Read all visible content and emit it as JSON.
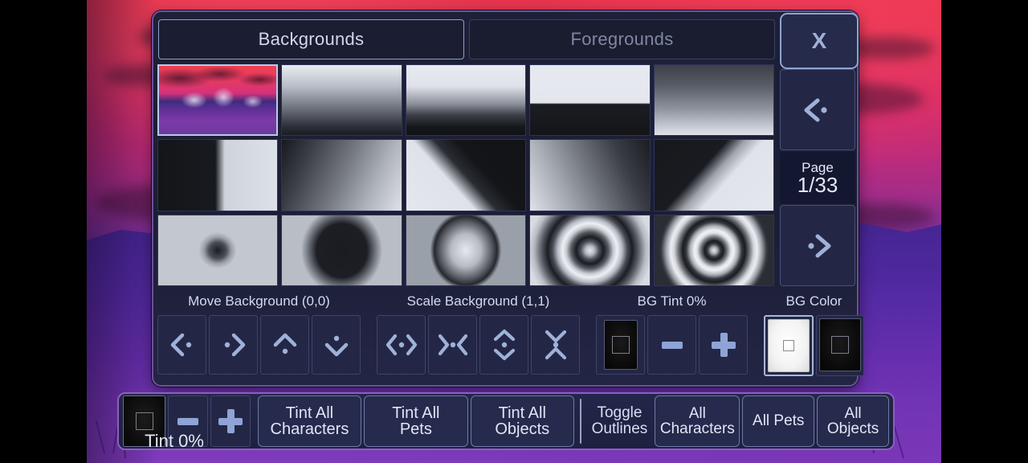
{
  "window": {
    "close_label": "X"
  },
  "tabs": [
    {
      "label": "Backgrounds",
      "active": true
    },
    {
      "label": "Foregrounds",
      "active": false
    }
  ],
  "pager": {
    "prev_icon": "chevron-left-icon",
    "next_icon": "chevron-right-icon",
    "page_label": "Page",
    "page_value": "1/33"
  },
  "grid": {
    "thumbnails": [
      {
        "index": 1,
        "name": "mountain-sunset-scene",
        "selected": true
      },
      {
        "index": 2,
        "name": "vertical-gradient-light-to-dark",
        "selected": false
      },
      {
        "index": 3,
        "name": "top-light-bottom-black-gradient",
        "selected": false
      },
      {
        "index": 4,
        "name": "hard-split-horizon",
        "selected": false
      },
      {
        "index": 5,
        "name": "dark-to-light-vertical",
        "selected": false
      },
      {
        "index": 6,
        "name": "hard-vertical-split",
        "selected": false
      },
      {
        "index": 7,
        "name": "diagonal-soft-gradient",
        "selected": false
      },
      {
        "index": 8,
        "name": "diagonal-split-dark-top",
        "selected": false
      },
      {
        "index": 9,
        "name": "corner-gradient",
        "selected": false
      },
      {
        "index": 10,
        "name": "diagonal-split-light-left",
        "selected": false
      },
      {
        "index": 11,
        "name": "small-radial-dark-center",
        "selected": false
      },
      {
        "index": 12,
        "name": "large-ellipse-dark",
        "selected": false
      },
      {
        "index": 13,
        "name": "radial-light-center",
        "selected": false
      },
      {
        "index": 14,
        "name": "concentric-rings-two",
        "selected": false
      },
      {
        "index": 15,
        "name": "concentric-rings-three",
        "selected": false
      }
    ]
  },
  "controls": {
    "move": {
      "label": "Move Background (0,0)",
      "buttons": [
        {
          "name": "move-left-button",
          "icon": "chevron-left-dot-icon"
        },
        {
          "name": "move-right-button",
          "icon": "chevron-right-dot-icon"
        },
        {
          "name": "move-up-button",
          "icon": "chevron-up-dot-icon"
        },
        {
          "name": "move-down-button",
          "icon": "chevron-down-dot-icon"
        }
      ]
    },
    "scale": {
      "label": "Scale Background (1,1)",
      "buttons": [
        {
          "name": "scale-wider-button",
          "icon": "expand-horizontal-icon"
        },
        {
          "name": "scale-narrower-button",
          "icon": "collapse-horizontal-icon"
        },
        {
          "name": "scale-taller-button",
          "icon": "expand-vertical-icon"
        },
        {
          "name": "scale-shorter-button",
          "icon": "collapse-vertical-icon"
        }
      ]
    },
    "bg_tint": {
      "label": "BG Tint 0%",
      "swatch_name": "bg-tint-swatch",
      "minus_name": "bg-tint-decrease-button",
      "plus_name": "bg-tint-increase-button"
    },
    "bg_color": {
      "label": "BG Color",
      "swatches": [
        {
          "name": "bg-color-swatch-white",
          "selected": true
        },
        {
          "name": "bg-color-swatch-black",
          "selected": false
        }
      ]
    }
  },
  "bottom_bar": {
    "tint_swatch_name": "tint-color-swatch",
    "tint_minus": "-",
    "tint_plus": "+",
    "tint_label": "Tint 0%",
    "buttons": [
      {
        "name": "tint-all-characters-button",
        "line1": "Tint All",
        "line2": "Characters"
      },
      {
        "name": "tint-all-pets-button",
        "line1": "Tint All",
        "line2": "Pets"
      },
      {
        "name": "tint-all-objects-button",
        "line1": "Tint All",
        "line2": "Objects"
      }
    ],
    "toggle_outlines": {
      "line1": "Toggle",
      "line2": "Outlines"
    },
    "outline_buttons": [
      {
        "name": "outline-all-characters-button",
        "line1": "All",
        "line2": "Characters"
      },
      {
        "name": "outline-all-pets-button",
        "line1": "All Pets",
        "line2": ""
      },
      {
        "name": "outline-all-objects-button",
        "line1": "All",
        "line2": "Objects"
      }
    ]
  },
  "colors": {
    "panel_bg": "#1d2038",
    "panel_border": "#6d4f9a",
    "accent_text": "#cfd8ea",
    "icon_blue": "#8fa4d6",
    "bottom_border": "#8b5fc0",
    "sky_pink": "#e03257",
    "ground_purple": "#6b2f9c"
  }
}
